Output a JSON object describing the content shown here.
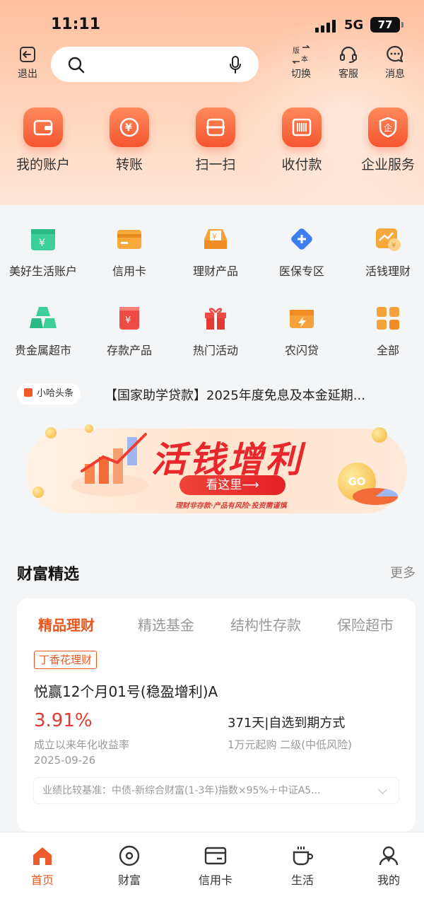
{
  "status": {
    "time": "11:11",
    "network": "5G",
    "battery": "77"
  },
  "header": {
    "exit_label": "退出",
    "switch_label": "切换",
    "switch_badge": "版本",
    "service_label": "客服",
    "message_label": "消息",
    "search_placeholder": ""
  },
  "quick_actions": [
    {
      "label": "我的账户",
      "icon": "wallet-icon"
    },
    {
      "label": "转账",
      "icon": "transfer-icon"
    },
    {
      "label": "扫一扫",
      "icon": "scan-icon"
    },
    {
      "label": "收付款",
      "icon": "barcode-icon"
    },
    {
      "label": "企业服务",
      "icon": "enterprise-icon"
    }
  ],
  "services": [
    {
      "label": "美好生活账户",
      "icon": "calendar-yuan-icon",
      "color": "#3ccf9a"
    },
    {
      "label": "信用卡",
      "icon": "credit-card-icon",
      "color": "#f7a93b"
    },
    {
      "label": "理财产品",
      "icon": "inbox-yuan-icon",
      "color": "#f5a23a"
    },
    {
      "label": "医保专区",
      "icon": "medical-plus-icon",
      "color": "#3d7ff0"
    },
    {
      "label": "活钱理财",
      "icon": "growth-coin-icon",
      "color": "#f7a83a"
    },
    {
      "label": "贵金属超市",
      "icon": "gold-bars-icon",
      "color": "#3ccf9a"
    },
    {
      "label": "存款产品",
      "icon": "deposit-yuan-icon",
      "color": "#ef4b45"
    },
    {
      "label": "热门活动",
      "icon": "gift-icon",
      "color": "#ef4b45"
    },
    {
      "label": "农闪贷",
      "icon": "flash-ticket-icon",
      "color": "#f5a23a"
    },
    {
      "label": "全部",
      "icon": "grid-all-icon",
      "color": "#f5a23a"
    }
  ],
  "news": {
    "tag": "小哈头条",
    "headline": "【国家助学贷款】2025年度免息及本金延期..."
  },
  "banner": {
    "title": "活钱增利",
    "button": "看这里⟶",
    "note": "理财非存款·产品有风险·投资需谨慎",
    "coin_text": "GO"
  },
  "wealth": {
    "title": "财富精选",
    "more": "更多",
    "tabs": [
      "精品理财",
      "精选基金",
      "结构性存款",
      "保险超市"
    ],
    "active_tab": 0,
    "product": {
      "tag": "丁香花理财",
      "name": "悦赢12个月01号(稳盈增利)A",
      "rate": "3.91%",
      "rate_label": "成立以来年化收益率",
      "date": "2025-09-26",
      "term": "371天|自选到期方式",
      "min": "1万元起购 二级(中低风险)",
      "benchmark": "业绩比较基准：中债-新综合财富(1-3年)指数×95%＋中证A5..."
    }
  },
  "bottom_nav": [
    {
      "label": "首页",
      "icon": "home-icon",
      "active": true
    },
    {
      "label": "财富",
      "icon": "wealth-icon",
      "active": false
    },
    {
      "label": "信用卡",
      "icon": "card-icon",
      "active": false
    },
    {
      "label": "生活",
      "icon": "coffee-icon",
      "active": false
    },
    {
      "label": "我的",
      "icon": "profile-icon",
      "active": false
    }
  ],
  "colors": {
    "accent": "#e8561e",
    "rate": "#e23a2e",
    "hero": "#ffc7a8"
  }
}
